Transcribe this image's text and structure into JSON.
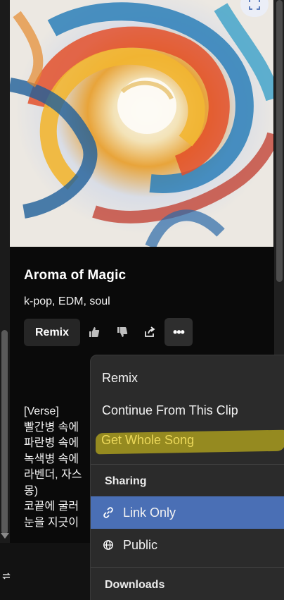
{
  "song": {
    "title": "Aroma of Magic",
    "tags": "k-pop, EDM, soul"
  },
  "actions": {
    "remix_label": "Remix",
    "more_label": "•••",
    "icons": [
      "thumbs-up-icon",
      "thumbs-down-icon",
      "share-icon",
      "more-icon"
    ]
  },
  "lyrics": [
    "[Verse]",
    "빨간병 속에",
    "파란병 속에",
    "녹색병 속에",
    "라벤더, 자스",
    "몽)",
    "코끝에 굴러",
    "눈을 지긋이"
  ],
  "menu": {
    "items": [
      {
        "label": "Remix"
      },
      {
        "label": "Continue From This Clip"
      },
      {
        "label": "Get Whole Song"
      }
    ],
    "sharing_header": "Sharing",
    "sharing_items": [
      {
        "label": "Link Only",
        "icon": "link-icon",
        "selected": true
      },
      {
        "label": "Public",
        "icon": "globe-icon",
        "selected": false
      }
    ],
    "downloads_header": "Downloads"
  },
  "colors": {
    "selected_item": "#4a6fb5",
    "highlight": "#a89b1e",
    "menu_bg": "#2b2b2b"
  }
}
